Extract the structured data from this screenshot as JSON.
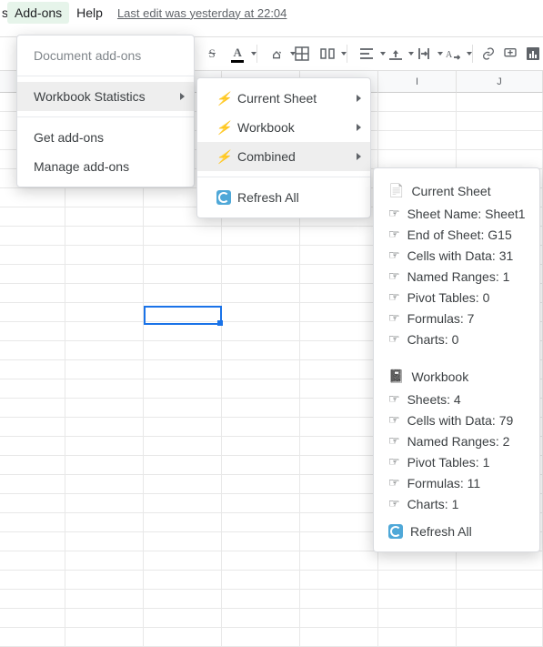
{
  "menubar": {
    "stub": "s",
    "addons": "Add-ons",
    "help": "Help",
    "last_edit": "Last edit was yesterday at 22:04"
  },
  "addons_menu": {
    "header": "Document add-ons",
    "workbook_stats": "Workbook Statistics",
    "get_addons": "Get add-ons",
    "manage_addons": "Manage add-ons"
  },
  "stats_menu": {
    "current_sheet": "Current Sheet",
    "workbook": "Workbook",
    "combined": "Combined",
    "refresh_all": "Refresh All"
  },
  "stats_panel": {
    "section_current": "Current Sheet",
    "cs_sheet_name": "Sheet Name: Sheet1",
    "cs_end": "End of Sheet: G15",
    "cs_cells": "Cells with Data: 31",
    "cs_named": "Named Ranges: 1",
    "cs_pivot": "Pivot Tables: 0",
    "cs_formulas": "Formulas: 7",
    "cs_charts": "Charts: 0",
    "section_workbook": "Workbook",
    "wb_sheets": "Sheets: 4",
    "wb_cells": "Cells with Data: 79",
    "wb_named": "Named Ranges: 2",
    "wb_pivot": "Pivot Tables: 1",
    "wb_formulas": "Formulas: 11",
    "wb_charts": "Charts: 1",
    "refresh_all": "Refresh All"
  },
  "columns": {
    "i": "I",
    "j": "J"
  }
}
